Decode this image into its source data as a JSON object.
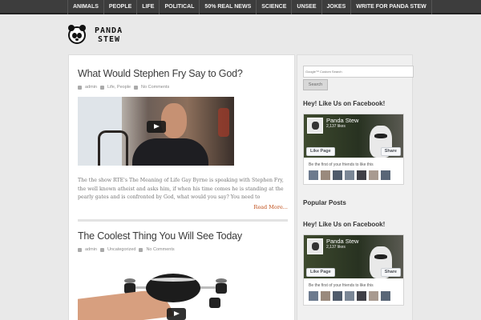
{
  "nav": {
    "items": [
      "Animals",
      "People",
      "Life",
      "Political",
      "50% Real News",
      "Science",
      "Unsee",
      "Jokes",
      "Write For Panda Stew"
    ]
  },
  "logo": {
    "line1": "PANDA",
    "line2": "STEW"
  },
  "posts": [
    {
      "title": "What Would Stephen Fry Say to God?",
      "author": "admin",
      "categories": "Life, People",
      "comments": "No Comments",
      "excerpt": "The the show RTE's The Meaning of Life Gay Byrne is speaking with Stephen Fry, the well known atheist and asks him, if when his time comes he is standing at the pearly gates and is confronted by God, what would you say? You need to",
      "read_more": "Read More..."
    },
    {
      "title": "The Coolest Thing You Will See Today",
      "author": "admin",
      "categories": "Uncategorized",
      "comments": "No Comments"
    }
  ],
  "sidebar": {
    "search_placeholder": "Google™ Custom Search",
    "search_button": "Search",
    "facebook_widgets": [
      {
        "title": "Hey! Like Us on Facebook!",
        "page_name": "Panda Stew",
        "likes": "2,137 likes",
        "like_btn": "Like Page",
        "share_btn": "Share",
        "first_text": "Be the first of your friends to like this"
      },
      {
        "title": "Hey! Like Us on Facebook!",
        "page_name": "Panda Stew",
        "likes": "2,137 likes",
        "like_btn": "Like Page",
        "share_btn": "Share",
        "first_text": "Be the first of your friends to like this"
      }
    ],
    "popular_title": "Popular Posts"
  },
  "colors": {
    "accent": "#c0501c",
    "nav_bg": "#3d3d3d",
    "page_bg": "#e9e9e9"
  }
}
